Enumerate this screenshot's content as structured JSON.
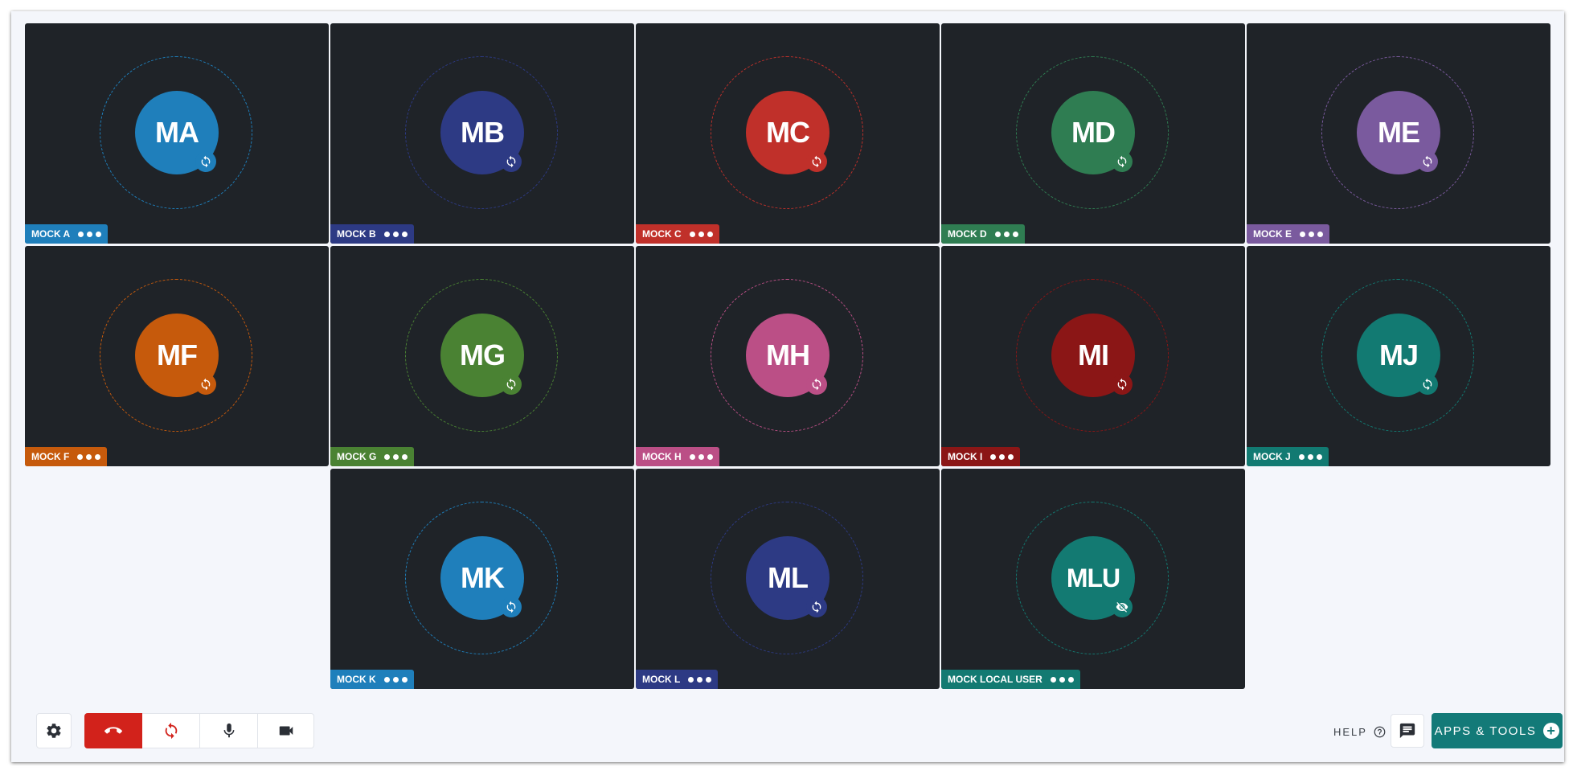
{
  "participants": [
    {
      "initials": "MA",
      "name": "MOCK A",
      "color": "#1f7fbb",
      "ring": "#1f7fbb",
      "status": "sync-icon"
    },
    {
      "initials": "MB",
      "name": "MOCK B",
      "color": "#2d3a84",
      "ring": "#2d3a84",
      "status": "sync-icon"
    },
    {
      "initials": "MC",
      "name": "MOCK C",
      "color": "#c0302a",
      "ring": "#c0302a",
      "status": "sync-icon"
    },
    {
      "initials": "MD",
      "name": "MOCK D",
      "color": "#2f7d52",
      "ring": "#2f7d52",
      "status": "sync-icon"
    },
    {
      "initials": "ME",
      "name": "MOCK E",
      "color": "#7a5a9e",
      "ring": "#7a5a9e",
      "status": "sync-icon"
    },
    {
      "initials": "MF",
      "name": "MOCK F",
      "color": "#c65a0c",
      "ring": "#c65a0c",
      "status": "sync-icon"
    },
    {
      "initials": "MG",
      "name": "MOCK G",
      "color": "#4a8233",
      "ring": "#4a8233",
      "status": "sync-icon"
    },
    {
      "initials": "MH",
      "name": "MOCK H",
      "color": "#bb4f86",
      "ring": "#bb4f86",
      "status": "sync-icon"
    },
    {
      "initials": "MI",
      "name": "MOCK I",
      "color": "#8b1616",
      "ring": "#8b1616",
      "status": "sync-icon"
    },
    {
      "initials": "MJ",
      "name": "MOCK J",
      "color": "#127a72",
      "ring": "#127a72",
      "status": "sync-icon"
    },
    {
      "initials": "MK",
      "name": "MOCK K",
      "color": "#1f7fbb",
      "ring": "#1f7fbb",
      "status": "sync-icon"
    },
    {
      "initials": "ML",
      "name": "MOCK L",
      "color": "#2d3a84",
      "ring": "#2d3a84",
      "status": "sync-icon"
    },
    {
      "initials": "MLU",
      "name": "MOCK LOCAL USER",
      "color": "#137a72",
      "ring": "#137a72",
      "status": "eye-off-icon"
    }
  ],
  "toolbar": {
    "settings_icon": "gear-icon",
    "hangup_icon": "phone-hangup-icon",
    "hangup_color": "#d2221b",
    "rejoin_icon": "sync-icon",
    "mic_icon": "microphone-icon",
    "camera_icon": "video-camera-icon"
  },
  "help": {
    "label": "HELP"
  },
  "chat": {
    "icon": "chat-icon"
  },
  "apps": {
    "label": "APPS & TOOLS",
    "color": "#137a78"
  }
}
